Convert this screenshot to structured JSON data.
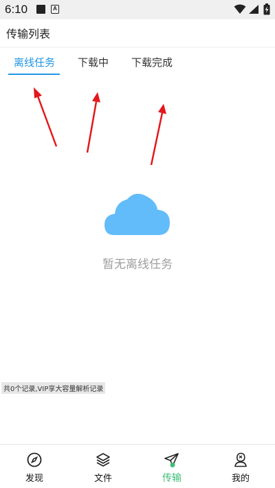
{
  "status_bar": {
    "time": "6:10",
    "notif_letter": "A"
  },
  "header": {
    "title": "传输列表"
  },
  "tabs": [
    {
      "label": "离线任务",
      "active": true
    },
    {
      "label": "下载中",
      "active": false
    },
    {
      "label": "下载完成",
      "active": false
    }
  ],
  "empty_state": {
    "text": "暂无离线任务"
  },
  "record_note": "共0个记录,VIP享大容量解析记录",
  "bottom_nav": [
    {
      "label": "发现",
      "icon": "compass-icon"
    },
    {
      "label": "文件",
      "icon": "layers-icon"
    },
    {
      "label": "传输",
      "icon": "send-icon",
      "active": true
    },
    {
      "label": "我的",
      "icon": "profile-icon"
    }
  ],
  "colors": {
    "accent": "#2196e3",
    "nav_active": "#3dbd75",
    "cloud": "#62bcfa",
    "annotation": "#e3181c"
  }
}
